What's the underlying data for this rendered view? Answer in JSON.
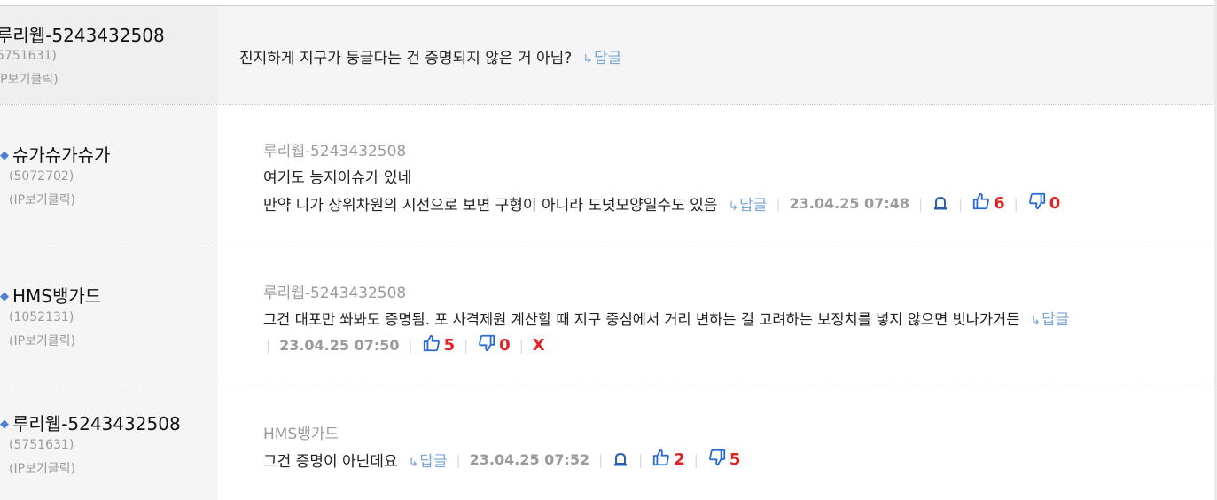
{
  "comments": [
    {
      "author": "루리웹-5243432508",
      "uid": "5751631)",
      "ip_link": "IP보기클릭)",
      "text": "진지하게 지구가 둥글다는 건 증명되지 않은 거 아님?",
      "reply_label": "답글"
    },
    {
      "author": "슈가슈가슈가",
      "uid": "(5072702)",
      "ip_link": "(IP보기클릭)",
      "reply_to": "루리웹-5243432508",
      "line1": "여기도 능지이슈가 있네",
      "line2": "만약 니가 상위차원의 시선으로 보면 구형이 아니라 도넛모양일수도 있음",
      "reply_label": "답글",
      "date": "23.04.25 07:48",
      "likes": "6",
      "dislikes": "0"
    },
    {
      "author": "HMS뱅가드",
      "uid": "(1052131)",
      "ip_link": "(IP보기클릭)",
      "reply_to": "루리웹-5243432508",
      "line1": "그건 대포만 쏴봐도 증명됨. 포 사격제원 계산할 때 지구 중심에서 거리 변하는 걸 고려하는 보정치를 넣지 않으면 빗나가거든",
      "reply_label": "답글",
      "date": "23.04.25 07:50",
      "likes": "5",
      "dislikes": "0",
      "delete_label": "X"
    },
    {
      "author": "루리웹-5243432508",
      "uid": "(5751631)",
      "ip_link": "(IP보기클릭)",
      "reply_to": "HMS뱅가드",
      "line1": "그건 증명이 아닌데요",
      "reply_label": "답글",
      "date": "23.04.25 07:52",
      "likes": "2",
      "dislikes": "5"
    }
  ],
  "icons": {
    "reply": "reply-arrow-icon",
    "bell": "report-bell-icon",
    "like": "thumbs-up-icon",
    "dislike": "thumbs-down-icon",
    "bullet": "author-bullet-icon"
  },
  "colors": {
    "reply_link": "#7ba4d9",
    "vote_count": "#e22222",
    "vote_icon": "#2a6ad6",
    "author_bullet": "#4d7fd6"
  }
}
